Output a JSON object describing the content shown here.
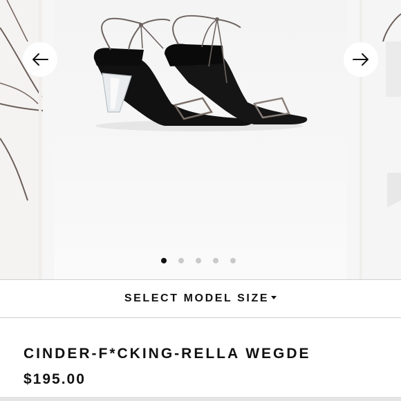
{
  "gallery": {
    "images": [
      {
        "icon": "sandal-straps-partial-image"
      },
      {
        "icon": "lace-up-wedge-sandals-image"
      },
      {
        "icon": "sandal-partial-image"
      }
    ],
    "prev_icon": "arrow-left-icon",
    "next_icon": "arrow-right-icon",
    "slide_count": 5,
    "active_slide": 1
  },
  "size_selector": {
    "label": "SELECT MODEL SIZE",
    "icon": "caret-down-icon"
  },
  "product": {
    "title": "CINDER-F*CKING-RELLA WEGDE",
    "price": "$195.00"
  },
  "colors": {
    "text": "#111111",
    "dot_active": "#111111",
    "dot_inactive": "#c9c9c9",
    "border": "#cfcfcf"
  }
}
